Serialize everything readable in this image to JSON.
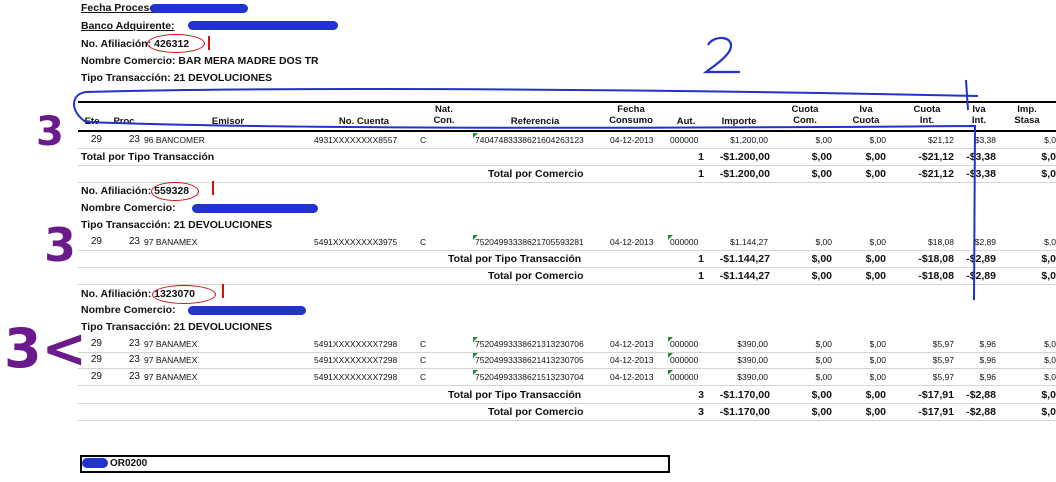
{
  "header": {
    "fecha_proceso": "Fecha Proceso:",
    "banco": "Banco Adquirente:",
    "afiliacion": "No. Afiliación: 426312",
    "comercio": "Nombre Comercio: BAR MERA MADRE DOS TR",
    "tipo": "Tipo Transacción: 21 DEVOLUCIONES"
  },
  "columns": {
    "ete": "Ete",
    "proc": "Proc",
    "emisor": "Emisor",
    "cuenta": "No. Cuenta",
    "nat": "Nat.\nCon.",
    "referencia": "Referencia",
    "fecha": "Fecha\nConsumo",
    "aut": "Aut.",
    "importe": "Importe",
    "cuota_com": "Cuota\nCom.",
    "iva_cuota": "Iva\nCuota",
    "cuota_int": "Cuota\nInt.",
    "iva_int": "Iva\nInt.",
    "imp": "Imp.\nStasa"
  },
  "group1": {
    "row": {
      "ete": "29",
      "proc": "23",
      "emisor": "96 BANCOMER",
      "cuenta": "4931XXXXXXXX8557",
      "nat": "C",
      "ref": "74047483338621604263123",
      "fecha": "04-12-2013",
      "aut": "000000",
      "importe": "$1,200,00",
      "cuota_com": "$,00",
      "iva_cuota": "$,00",
      "cuota_int": "$21,12",
      "iva_int": "$3,38",
      "imp": "$,0"
    },
    "total_tipo": {
      "label": "Total por Tipo Transacción",
      "n": "1",
      "importe": "-$1.200,00",
      "cuota_com": "$,00",
      "iva_cuota": "$,00",
      "cuota_int": "-$21,12",
      "iva_int": "-$3,38",
      "imp": "$,0"
    },
    "total_comercio": {
      "label": "Total por Comercio",
      "n": "1",
      "importe": "-$1.200,00",
      "cuota_com": "$,00",
      "iva_cuota": "$,00",
      "cuota_int": "-$21,12",
      "iva_int": "-$3,38",
      "imp": "$,0"
    }
  },
  "group2": {
    "afiliacion": "No. Afiliación: 559328",
    "comercio": "Nombre Comercio:",
    "tipo": "Tipo Transacción: 21 DEVOLUCIONES",
    "row": {
      "ete": "29",
      "proc": "23",
      "emisor": "97 BANAMEX",
      "cuenta": "5491XXXXXXXX3975",
      "nat": "C",
      "ref": "75204993338621705593281",
      "fecha": "04-12-2013",
      "aut": "000000",
      "importe": "$1.144,27",
      "cuota_com": "$,00",
      "iva_cuota": "$,00",
      "cuota_int": "$18,08",
      "iva_int": "$2,89",
      "imp": "$,0"
    },
    "total_tipo": {
      "label": "Total por Tipo Transacción",
      "n": "1",
      "importe": "-$1.144,27",
      "cuota_com": "$,00",
      "iva_cuota": "$,00",
      "cuota_int": "-$18,08",
      "iva_int": "-$2,89",
      "imp": "$,0"
    },
    "total_comercio": {
      "label": "Total por Comercio",
      "n": "1",
      "importe": "-$1.144,27",
      "cuota_com": "$,00",
      "iva_cuota": "$,00",
      "cuota_int": "-$18,08",
      "iva_int": "-$2,89",
      "imp": "$,0"
    }
  },
  "group3": {
    "afiliacion": "No. Afiliación: 1323070",
    "comercio": "Nombre Comercio:",
    "tipo": "Tipo Transacción: 21 DEVOLUCIONES",
    "rows": [
      {
        "ete": "29",
        "proc": "23",
        "emisor": "97 BANAMEX",
        "cuenta": "5491XXXXXXXX7298",
        "nat": "C",
        "ref": "75204993338621313230706",
        "fecha": "04-12-2013",
        "aut": "000000",
        "importe": "$390,00",
        "cuota_com": "$,00",
        "iva_cuota": "$,00",
        "cuota_int": "$5,97",
        "iva_int": "$,96",
        "imp": "$,0"
      },
      {
        "ete": "29",
        "proc": "23",
        "emisor": "97 BANAMEX",
        "cuenta": "5491XXXXXXXX7298",
        "nat": "C",
        "ref": "75204993338621413230705",
        "fecha": "04-12-2013",
        "aut": "000000",
        "importe": "$390,00",
        "cuota_com": "$,00",
        "iva_cuota": "$,00",
        "cuota_int": "$5,97",
        "iva_int": "$,96",
        "imp": "$,0"
      },
      {
        "ete": "29",
        "proc": "23",
        "emisor": "97 BANAMEX",
        "cuenta": "5491XXXXXXXX7298",
        "nat": "C",
        "ref": "75204993338621513230704",
        "fecha": "04-12-2013",
        "aut": "000000",
        "importe": "$390,00",
        "cuota_com": "$,00",
        "iva_cuota": "$,00",
        "cuota_int": "$5,97",
        "iva_int": "$,96",
        "imp": "$,0"
      }
    ],
    "total_tipo": {
      "label": "Total por Tipo Transacción",
      "n": "3",
      "importe": "-$1.170,00",
      "cuota_com": "$,00",
      "iva_cuota": "$,00",
      "cuota_int": "-$17,91",
      "iva_int": "-$2,88",
      "imp": "$,0"
    },
    "total_comercio": {
      "label": "Total por Comercio",
      "n": "3",
      "importe": "-$1.170,00",
      "cuota_com": "$,00",
      "iva_cuota": "$,00",
      "cuota_int": "-$17,91",
      "iva_int": "-$2,88",
      "imp": "$,0"
    }
  },
  "footer": {
    "code": "OR0200"
  },
  "annotations": {
    "a1": "1",
    "a2": "2",
    "a3": "3",
    "a4": "3",
    "a5": "3<"
  },
  "colors": {
    "annotation_red": "#d21010",
    "annotation_blue": "#2233cc",
    "annotation_purple": "#6a1a8a"
  }
}
